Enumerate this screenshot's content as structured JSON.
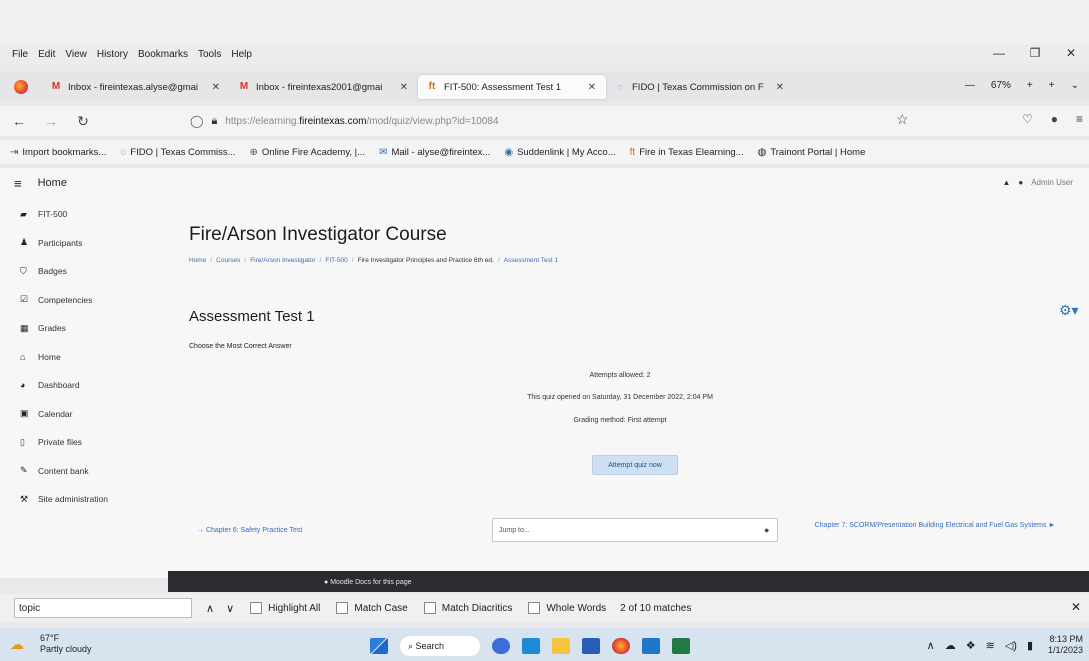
{
  "menu": [
    "File",
    "Edit",
    "View",
    "History",
    "Bookmarks",
    "Tools",
    "Help"
  ],
  "window_controls": [
    "—",
    "❐",
    "✕"
  ],
  "tabs": [
    {
      "label": "Inbox - fireintexas.alyse@gmai",
      "icon": "gmail-icon",
      "active": false
    },
    {
      "label": "Inbox - fireintexas2001@gmai",
      "icon": "gmail-icon",
      "active": false
    },
    {
      "label": "FIT-500: Assessment Test 1",
      "icon": "fire-in-texas-icon",
      "active": true
    },
    {
      "label": "FIDO | Texas Commission on F",
      "icon": "fido-icon",
      "active": false
    }
  ],
  "zoom": {
    "minus": "—",
    "level": "67%",
    "plus": "+"
  },
  "url": {
    "prefix": "https://elearning.",
    "domain": "fireintexas.com",
    "path": "/mod/quiz/view.php?id=10084"
  },
  "bookmarks": [
    {
      "label": "Import bookmarks...",
      "icon": "import-icon"
    },
    {
      "label": "FIDO | Texas Commiss...",
      "icon": "fido-icon"
    },
    {
      "label": "Online Fire Academy, |...",
      "icon": "globe-icon"
    },
    {
      "label": "Mail - alyse@fireintex...",
      "icon": "mail-icon"
    },
    {
      "label": "Suddenlink | My Acco...",
      "icon": "user-icon"
    },
    {
      "label": "Fire in Texas Elearning...",
      "icon": "fire-in-texas-icon"
    },
    {
      "label": "Trainont Portal | Home",
      "icon": "portal-icon"
    }
  ],
  "header": {
    "home": "Home",
    "user": "Admin User"
  },
  "sidebar": [
    {
      "label": "FIT-500",
      "icon": "graduation-cap-icon"
    },
    {
      "label": "Participants",
      "icon": "users-icon"
    },
    {
      "label": "Badges",
      "icon": "shield-icon"
    },
    {
      "label": "Competencies",
      "icon": "checkbox-icon"
    },
    {
      "label": "Grades",
      "icon": "table-icon"
    },
    {
      "label": "Home",
      "icon": "home-icon"
    },
    {
      "label": "Dashboard",
      "icon": "dashboard-icon"
    },
    {
      "label": "Calendar",
      "icon": "calendar-icon"
    },
    {
      "label": "Private files",
      "icon": "file-icon"
    },
    {
      "label": "Content bank",
      "icon": "pencil-icon"
    },
    {
      "label": "Site administration",
      "icon": "wrench-icon"
    }
  ],
  "course_title": "Fire/Arson Investigator Course",
  "breadcrumb": [
    "Home",
    "Courses",
    "Fire/Arson Investigator",
    "FIT-500",
    "Fire Investigator Principles and Practice 6th ed.",
    "Assessment Test 1"
  ],
  "quiz": {
    "title": "Assessment Test 1",
    "instructions": "Choose the Most Correct Answer",
    "attempts": "Attempts allowed: 2",
    "opened": "This quiz opened on Saturday, 31 December 2022, 2:04 PM",
    "grading": "Grading method: First attempt",
    "button": "Attempt quiz now"
  },
  "nav": {
    "prev": "→ Chapter 6: Safety Practice Test",
    "jump_placeholder": "Jump to...",
    "next": "Chapter 7: SCORM/Presentation Building Electrical and Fuel Gas Systems ►"
  },
  "footer": {
    "docs": "Moodle Docs for this page"
  },
  "findbar": {
    "query": "topic",
    "highlight_all": "Highlight All",
    "match_case": "Match Case",
    "match_diacritics": "Match Diacritics",
    "whole_words": "Whole Words",
    "matches": "2 of 10 matches"
  },
  "taskbar": {
    "temp": "67°F",
    "condition": "Partly cloudy",
    "search": "Search",
    "time": "8:13 PM",
    "date": "1/1/2023"
  },
  "colors": {
    "link": "#3c6fb5",
    "footer": "#2c2c30",
    "button": "#cfe0f2",
    "taskbar": "#d8e3f0"
  }
}
